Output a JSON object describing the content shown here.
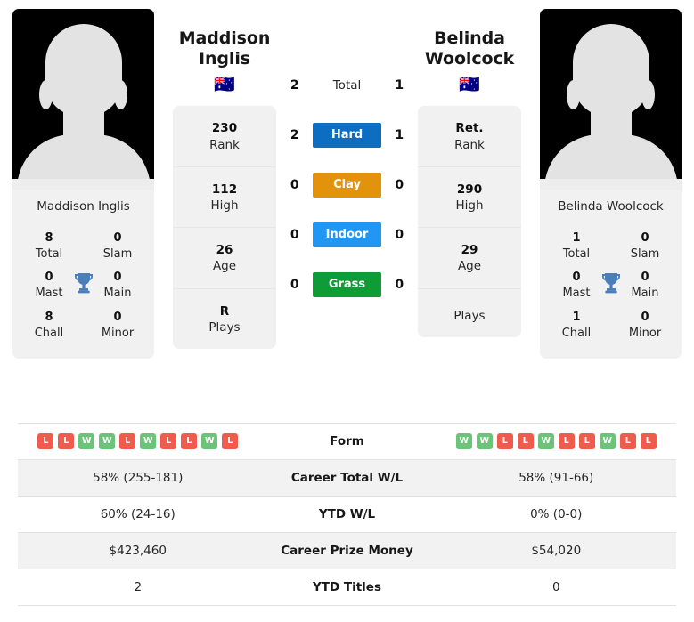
{
  "players": {
    "left": {
      "name_lines": [
        "Maddison",
        "Inglis"
      ],
      "full_name": "Maddison Inglis",
      "flag": "🇦🇺",
      "photo_caption": "Maddison Inglis",
      "titles": {
        "total_value": "8",
        "total_label": "Total",
        "slam_value": "0",
        "slam_label": "Slam",
        "mast_value": "0",
        "mast_label": "Mast",
        "main_value": "0",
        "main_label": "Main",
        "chall_value": "8",
        "chall_label": "Chall",
        "minor_value": "0",
        "minor_label": "Minor"
      },
      "card": [
        {
          "value": "230",
          "label": "Rank"
        },
        {
          "value": "112",
          "label": "High"
        },
        {
          "value": "26",
          "label": "Age"
        },
        {
          "value": "R",
          "label": "Plays"
        }
      ],
      "form": [
        "L",
        "L",
        "W",
        "W",
        "L",
        "W",
        "L",
        "L",
        "W",
        "L"
      ],
      "career_total_wl": "58% (255-181)",
      "ytd_wl": "60% (24-16)",
      "career_prize_money": "$423,460",
      "ytd_titles": "2"
    },
    "right": {
      "name_lines": [
        "Belinda",
        "Woolcock"
      ],
      "full_name": "Belinda Woolcock",
      "flag": "🇦🇺",
      "photo_caption": "Belinda Woolcock",
      "titles": {
        "total_value": "1",
        "total_label": "Total",
        "slam_value": "0",
        "slam_label": "Slam",
        "mast_value": "0",
        "mast_label": "Mast",
        "main_value": "0",
        "main_label": "Main",
        "chall_value": "1",
        "chall_label": "Chall",
        "minor_value": "0",
        "minor_label": "Minor"
      },
      "card": [
        {
          "value": "Ret.",
          "label": "Rank"
        },
        {
          "value": "290",
          "label": "High"
        },
        {
          "value": "29",
          "label": "Age"
        },
        {
          "value": "",
          "label": "Plays"
        }
      ],
      "form": [
        "W",
        "W",
        "L",
        "L",
        "W",
        "L",
        "L",
        "W",
        "L",
        "L"
      ],
      "career_total_wl": "58% (91-66)",
      "ytd_wl": "0% (0-0)",
      "career_prize_money": "$54,020",
      "ytd_titles": "0"
    }
  },
  "surfaces": [
    {
      "label": "Total",
      "left": "2",
      "right": "1",
      "color": "",
      "plain": true
    },
    {
      "label": "Hard",
      "left": "2",
      "right": "1",
      "color": "#0d6ec1",
      "plain": false
    },
    {
      "label": "Clay",
      "left": "0",
      "right": "0",
      "color": "#e3930b",
      "plain": false
    },
    {
      "label": "Indoor",
      "left": "0",
      "right": "0",
      "color": "#2196f3",
      "plain": false
    },
    {
      "label": "Grass",
      "left": "0",
      "right": "0",
      "color": "#0e9c36",
      "plain": false
    }
  ],
  "table": {
    "rows": [
      {
        "label": "Form",
        "kind": "form",
        "left": "",
        "right": ""
      },
      {
        "label": "Career Total W/L",
        "kind": "text",
        "left": "58% (255-181)",
        "right": "58% (91-66)"
      },
      {
        "label": "YTD W/L",
        "kind": "text",
        "left": "60% (24-16)",
        "right": "0% (0-0)"
      },
      {
        "label": "Career Prize Money",
        "kind": "text",
        "left": "$423,460",
        "right": "$54,020"
      },
      {
        "label": "YTD Titles",
        "kind": "text",
        "left": "2",
        "right": "0"
      }
    ]
  },
  "colors": {
    "win_badge": "#6cc47b",
    "loss_badge": "#ef5b4c",
    "trophy": "#4a7ebb",
    "card_bg": "#f1f1f1",
    "row_alt_bg": "#f2f2f2"
  }
}
